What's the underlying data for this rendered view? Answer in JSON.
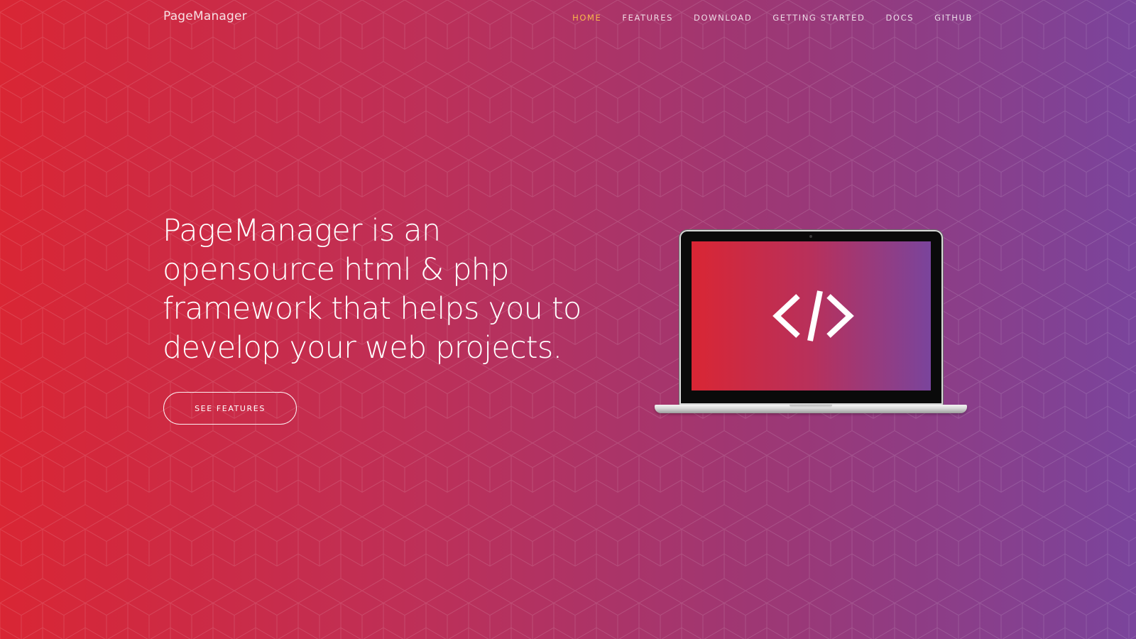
{
  "nav": {
    "brand": "PageManager",
    "links": [
      {
        "label": "HOME",
        "active": true
      },
      {
        "label": "FEATURES",
        "active": false
      },
      {
        "label": "DOWNLOAD",
        "active": false
      },
      {
        "label": "GETTING STARTED",
        "active": false
      },
      {
        "label": "DOCS",
        "active": false
      },
      {
        "label": "GITHUB",
        "active": false
      }
    ]
  },
  "hero": {
    "headline": "PageManager is an opensource html & php framework that helps you to develop your web projects.",
    "cta_label": "SEE FEATURES",
    "illustration_icon": "code-brackets-icon"
  },
  "colors": {
    "gradient_start": "#d92634",
    "gradient_end": "#7a449c",
    "active_nav": "#f7b84a",
    "text": "#ffffff"
  }
}
